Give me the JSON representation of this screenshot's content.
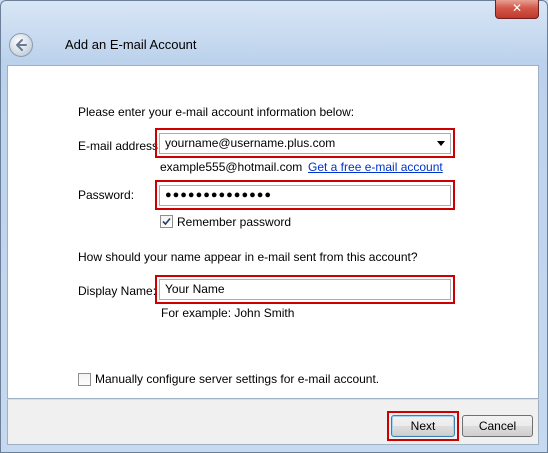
{
  "window": {
    "title": "Add an E-mail Account",
    "close_glyph": "✕",
    "icons": {
      "close": "close-icon",
      "back": "back-arrow-icon"
    }
  },
  "form": {
    "intro": "Please enter your e-mail account information below:",
    "email": {
      "label": "E-mail address:",
      "value": "yourname@username.plus.com",
      "example": "example555@hotmail.com",
      "free_link": "Get a free e-mail account"
    },
    "password": {
      "label": "Password:",
      "value": "●●●●●●●●●●●●●●",
      "remember_label": "Remember password",
      "remember_checked": true
    },
    "name_question": "How should your name appear in e-mail sent from this account?",
    "display_name": {
      "label": "Display Name:",
      "value": "Your Name",
      "example": "For example: John Smith"
    },
    "manual": {
      "label": "Manually configure server settings for e-mail account.",
      "checked": false
    }
  },
  "buttons": {
    "next": "Next",
    "cancel": "Cancel"
  },
  "colors": {
    "highlight": "#cc0000",
    "link": "#0033cc"
  }
}
